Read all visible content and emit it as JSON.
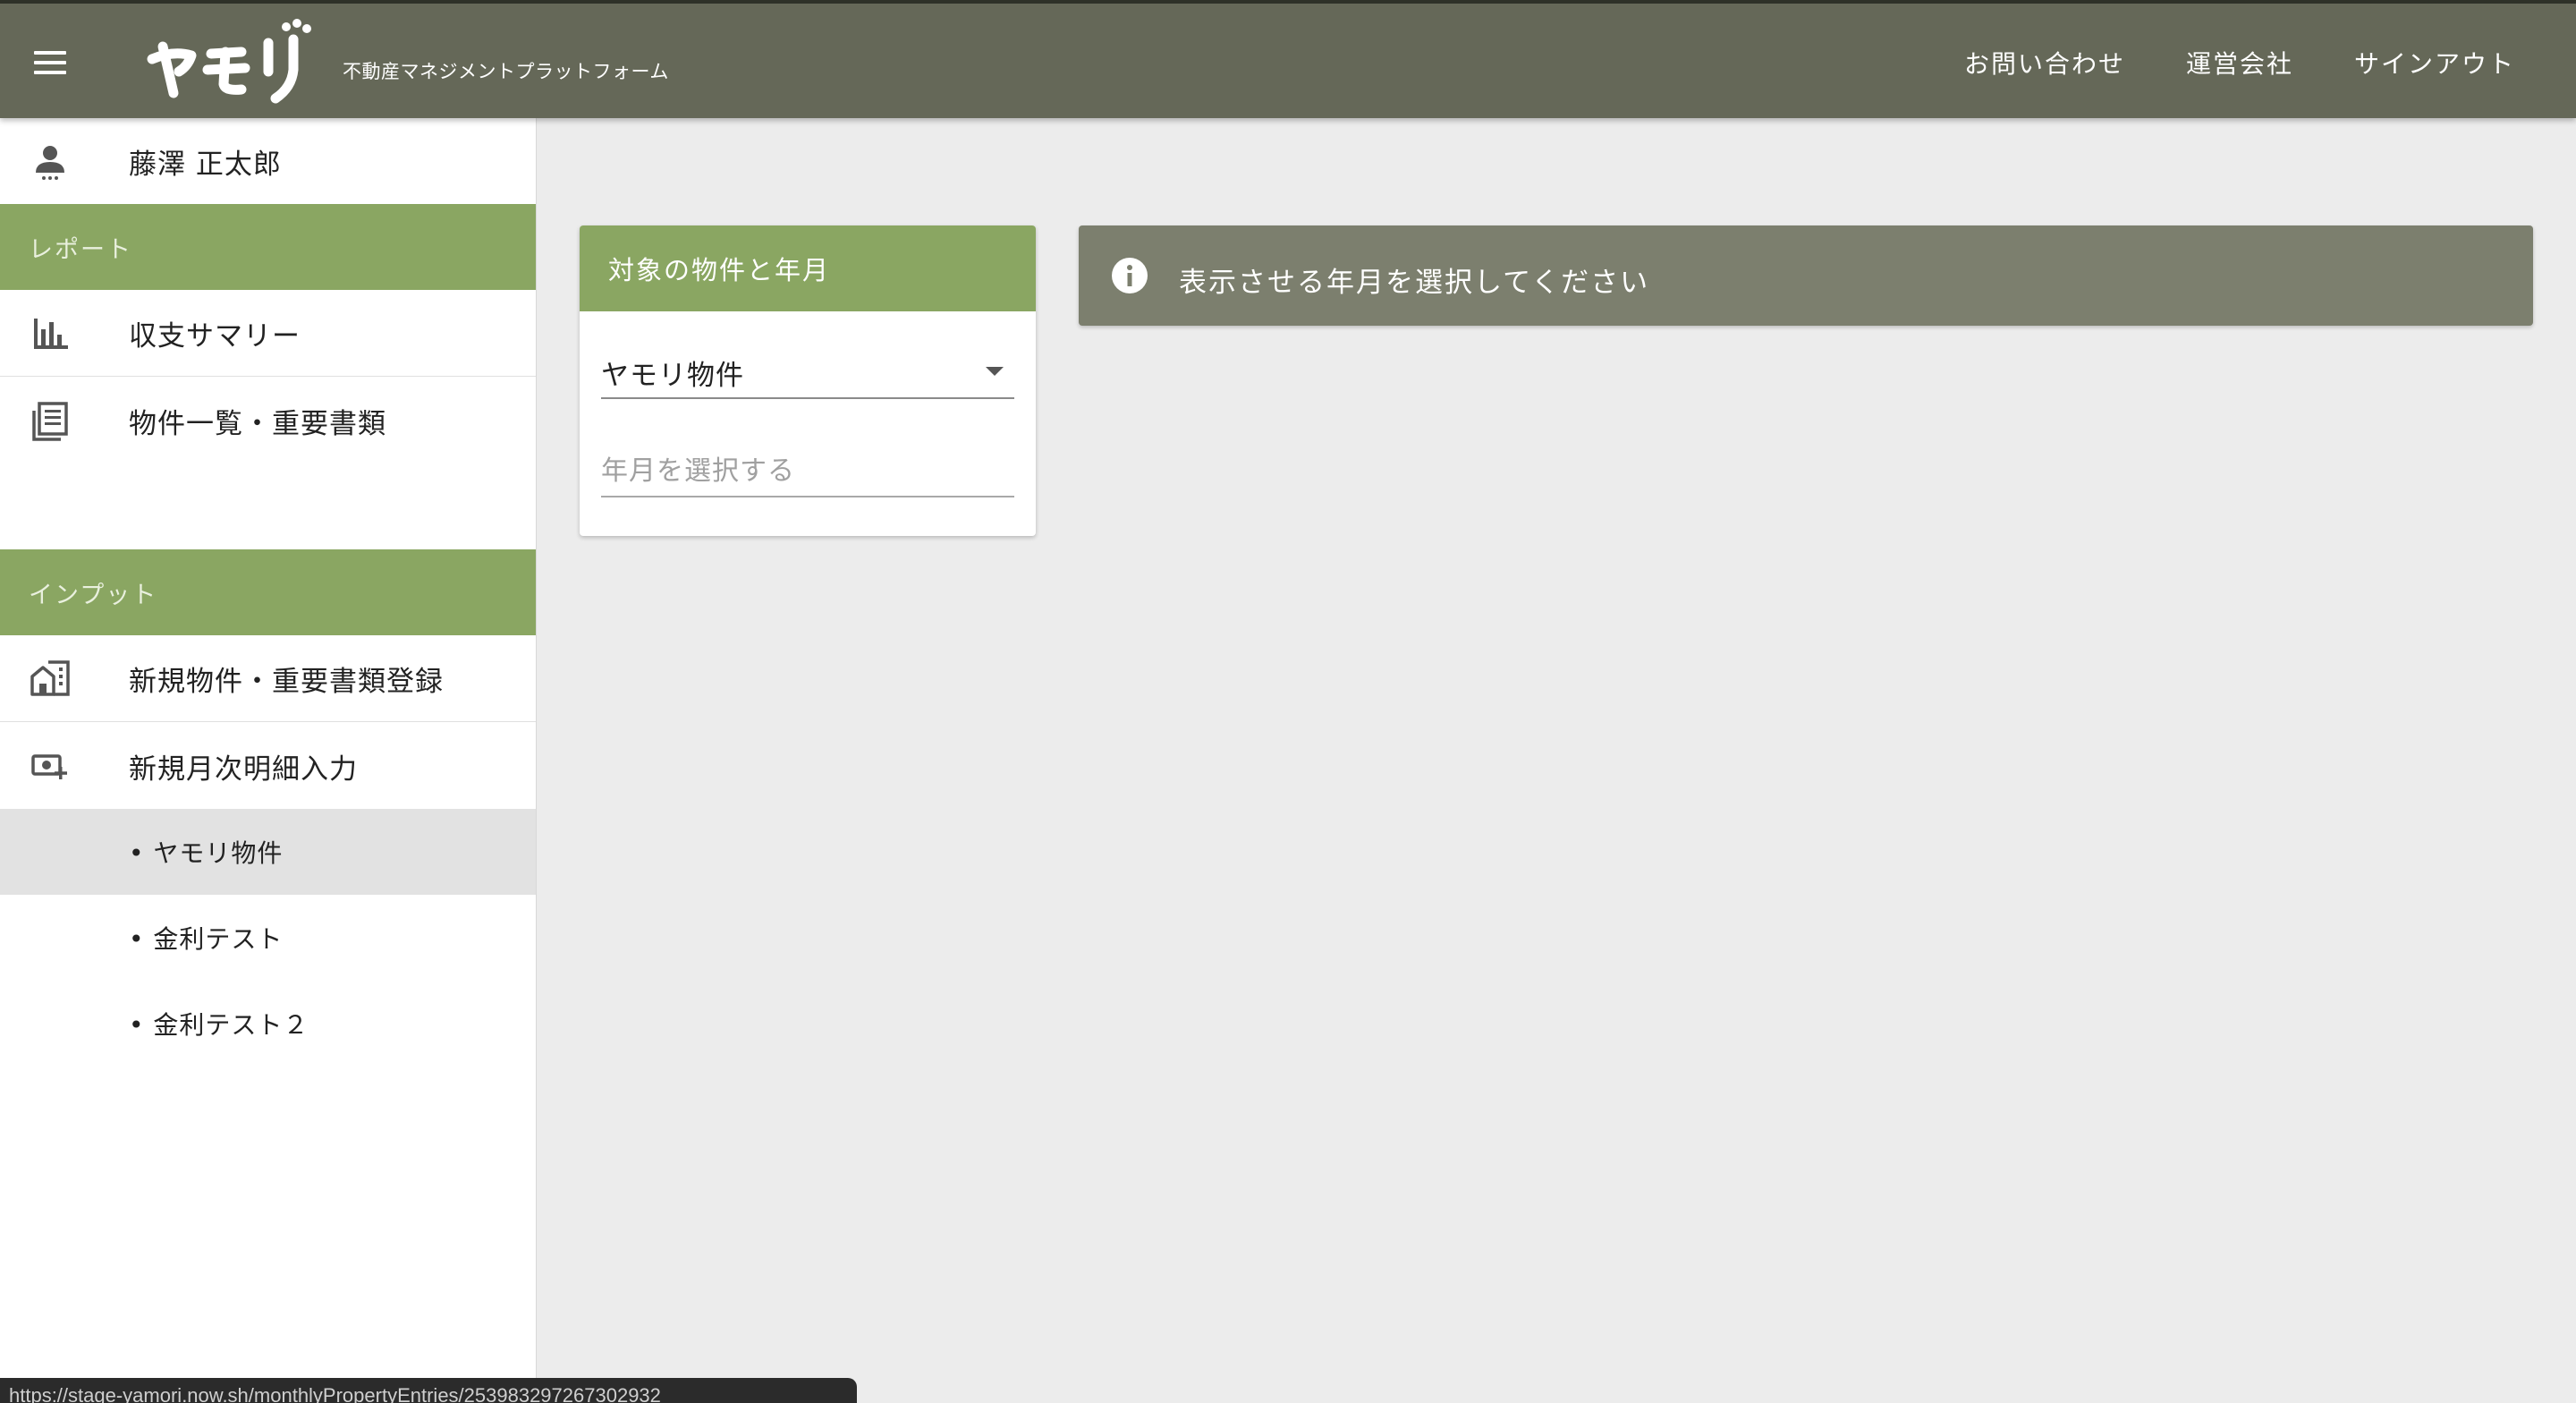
{
  "header": {
    "menu_icon": "hamburger-menu-icon",
    "logo_text": "ヤモリ",
    "tagline": "不動産マネジメントプラットフォーム",
    "links": {
      "contact": "お問い合わせ",
      "company": "運営会社",
      "signout": "サインアウト"
    },
    "bar_color": "#656858"
  },
  "sidebar": {
    "user": {
      "icon": "person-icon",
      "name": "藤澤 正太郎"
    },
    "report_header": "レポート",
    "report_items": [
      {
        "icon": "bar-chart-icon",
        "label": "収支サマリー"
      },
      {
        "icon": "document-list-icon",
        "label": "物件一覧・重要書類"
      }
    ],
    "input_header": "インプット",
    "input_items": [
      {
        "icon": "building-icon",
        "label": "新規物件・重要書類登録"
      },
      {
        "icon": "add-money-icon",
        "label": "新規月次明細入力"
      }
    ],
    "sub_items": [
      {
        "label": "• ヤモリ物件",
        "active": true
      },
      {
        "label": "• 金利テスト",
        "active": false
      },
      {
        "label": "• 金利テスト２",
        "active": false
      }
    ],
    "section_color": "#8aa662"
  },
  "card": {
    "title": "対象の物件と年月",
    "property_select": {
      "value": "ヤモリ物件"
    },
    "month_input": {
      "value": "",
      "placeholder": "年月を選択する"
    }
  },
  "alert": {
    "icon": "info-icon",
    "message": "表示させる年月を選択してください",
    "color": "#7c7f6e"
  },
  "status_bar": {
    "url": "https://stage-yamori.now.sh/monthlyPropertyEntries/253983297267302932"
  }
}
